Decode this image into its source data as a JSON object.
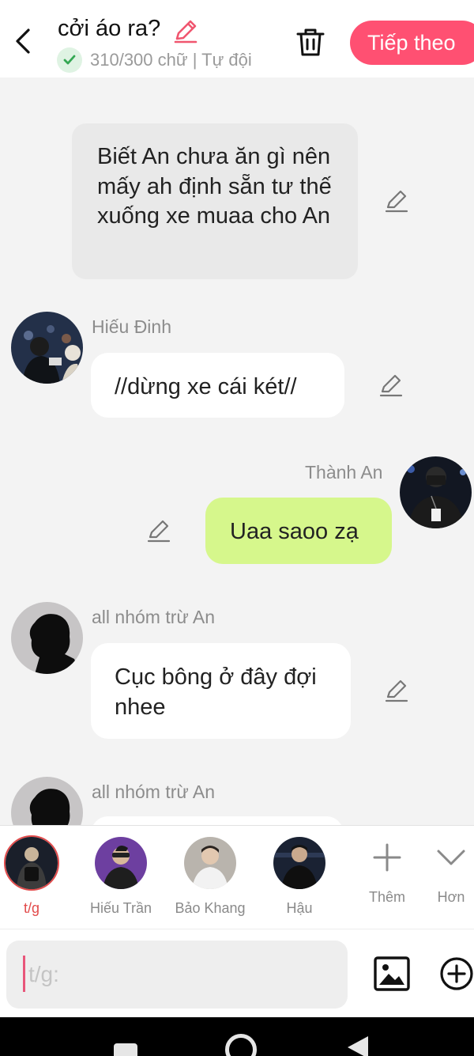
{
  "header": {
    "title": "cởi áo ra?",
    "word_count": "310/300 chữ | Tự đội",
    "next_label": "Tiếp theo",
    "accent_color": "#ff5072"
  },
  "messages": [
    {
      "type": "narration",
      "text": "Biết An chưa ăn gì nên mấy ah định sẵn tư thế xuống xe muaa cho An"
    },
    {
      "type": "incoming",
      "name": "Hiếu Đinh",
      "text": "//dừng xe cái két//"
    },
    {
      "type": "outgoing",
      "name": "Thành An",
      "text": "Uaa saoo zạ"
    },
    {
      "type": "incoming",
      "name": "all nhóm trừ An",
      "text": "Cục bông ở đây đợi nhee"
    },
    {
      "type": "incoming",
      "name": "all nhóm trừ An",
      "text": ""
    }
  ],
  "characters": [
    {
      "name": "t/g",
      "selected": true
    },
    {
      "name": "Hiếu Trần",
      "selected": false
    },
    {
      "name": "Bảo Khang",
      "selected": false
    },
    {
      "name": "Hậu",
      "selected": false
    }
  ],
  "tools": {
    "add_label": "Thêm",
    "more_label": "Hơn"
  },
  "input": {
    "placeholder": "t/g:"
  },
  "icons": [
    "back-arrow-icon",
    "pencil-icon",
    "check-icon",
    "trash-icon",
    "image-icon",
    "plus-circle-icon",
    "plus-icon",
    "chevron-down-icon"
  ]
}
